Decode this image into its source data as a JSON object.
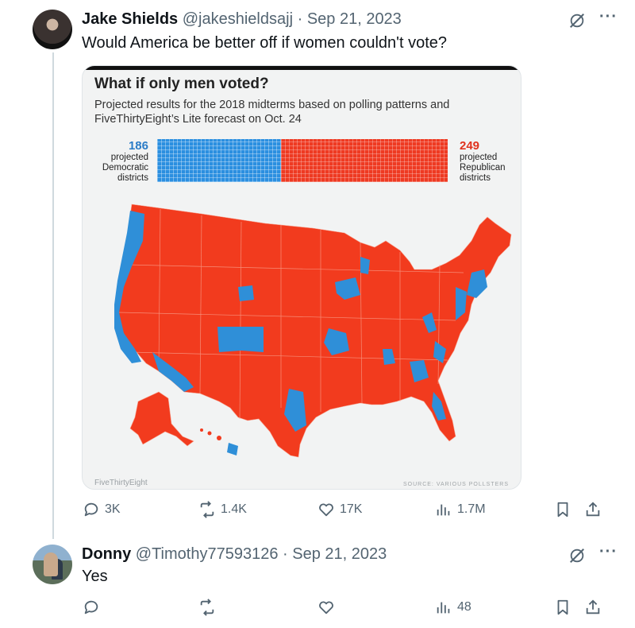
{
  "tweet": {
    "name": "Jake Shields",
    "handle": "@jakeshieldsajj",
    "separator": "·",
    "date": "Sep 21, 2023",
    "text": "Would America be better off if women couldn't vote?",
    "stats": {
      "replies": "3K",
      "reposts": "1.4K",
      "likes": "17K",
      "views": "1.7M"
    }
  },
  "image": {
    "title": "What if only men voted?",
    "subtitle": "Projected results for the 2018 midterms based on polling patterns and FiveThirtyEight’s Lite forecast on Oct. 24",
    "dem_count": "186",
    "dem_label": "projected Democratic districts",
    "rep_count": "249",
    "rep_label": "projected Republican districts",
    "dem_seats": 186,
    "rep_seats": 249,
    "dem_color": "#2b8fe0",
    "rep_color": "#ee3a22",
    "credit": "FiveThirtyEight",
    "source": "SOURCE: VARIOUS POLLSTERS"
  },
  "reply": {
    "name": "Donny",
    "handle": "@Timothy77593126",
    "separator": "·",
    "date": "Sep 21, 2023",
    "text": "Yes",
    "stats": {
      "views": "48"
    }
  },
  "icons": [
    "grok-icon",
    "more-icon",
    "reply-icon",
    "repost-icon",
    "like-icon",
    "views-icon",
    "bookmark-icon",
    "share-icon"
  ]
}
